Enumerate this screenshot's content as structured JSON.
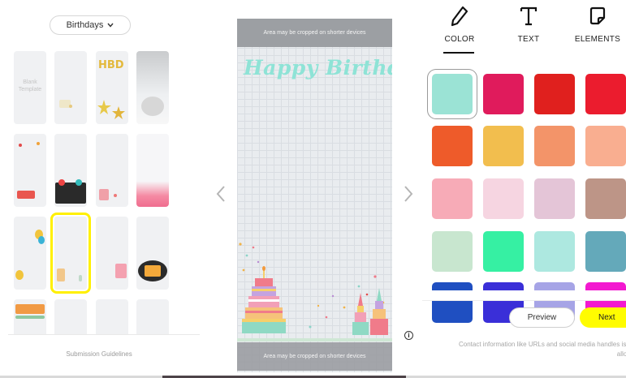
{
  "template_panel": {
    "category_label": "Birthdays",
    "blank_template_label": "Blank Template",
    "submission_link": "Submission Guidelines"
  },
  "canvas": {
    "crop_notice_top": "Area may be cropped on shorter devices",
    "crop_notice_bottom": "Area may be cropped on shorter devices",
    "headline": "Happy Birthday",
    "hbd_tile_text": "HBD"
  },
  "tools": {
    "tabs": [
      {
        "label": "COLOR",
        "icon": "pencil-icon",
        "active": true
      },
      {
        "label": "TEXT",
        "icon": "text-t-icon",
        "active": false
      },
      {
        "label": "ELEMENTS",
        "icon": "sticker-icon",
        "active": false
      }
    ]
  },
  "colors": {
    "selected": "#9be3d5",
    "swatches": [
      "#9be3d5",
      "#e01b5c",
      "#e0201e",
      "#eb1c2e",
      "#ee5b2a",
      "#f2be4e",
      "#f39469",
      "#f9ae90",
      "#f7abb7",
      "#f6d5e1",
      "#e4c5d7",
      "#bd9587",
      "#c8e6cf",
      "#36f0a3",
      "#ade8e0",
      "#64a9ba",
      "#1f4fc1",
      "#3a2fd8",
      "#a6a4e6",
      "#f319d0"
    ]
  },
  "actions": {
    "preview_label": "Preview",
    "next_label": "Next",
    "contact_note_line1": "Contact information like URLs and social media handles is n",
    "contact_note_line2": "allow"
  },
  "accent": "#fffc00"
}
